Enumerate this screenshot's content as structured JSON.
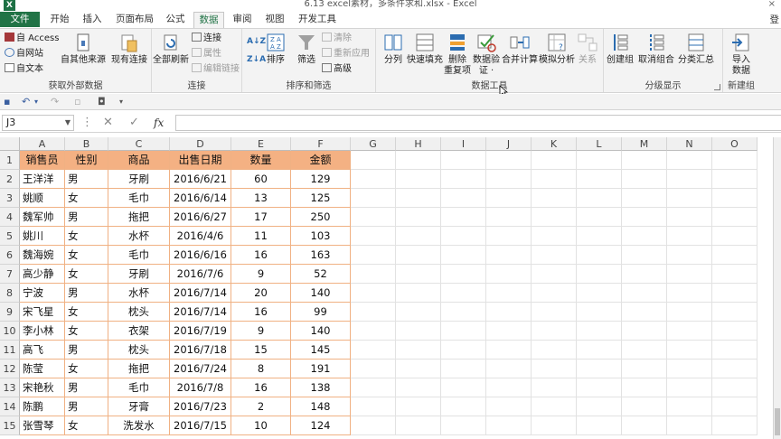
{
  "window": {
    "title": "6.13 excel素材，多条件求和.xlsx - Excel",
    "login": "登"
  },
  "tabs": [
    "文件",
    "开始",
    "插入",
    "页面布局",
    "公式",
    "数据",
    "审阅",
    "视图",
    "开发工具"
  ],
  "ribbon": {
    "get_external": {
      "access": "自 Access",
      "web": "自网站",
      "text": "自文本",
      "other": "自其他来源",
      "existing": "现有连接",
      "label": "获取外部数据"
    },
    "connections": {
      "refresh_all": "全部刷新",
      "connections": "连接",
      "properties": "属性",
      "edit_links": "编辑链接",
      "label": "连接"
    },
    "sort_filter": {
      "sort": "排序",
      "filter": "筛选",
      "clear": "清除",
      "reapply": "重新应用",
      "advanced": "高级",
      "label": "排序和筛选"
    },
    "data_tools": {
      "text_to_columns": "分列",
      "flash_fill": "快速填充",
      "remove_dup_1": "删除",
      "remove_dup_2": "重复项",
      "validation_1": "数据验",
      "validation_2": "证 ·",
      "consolidate": "合并计算",
      "what_if": "模拟分析",
      "relationships": "关系",
      "label": "数据工具"
    },
    "outline": {
      "group": "创建组",
      "ungroup": "取消组合",
      "subtotal": "分类汇总",
      "label": "分级显示"
    },
    "new_group": {
      "import_1": "导入",
      "import_2": "数据",
      "label": "新建组"
    }
  },
  "formula_bar": {
    "name_box": "J3",
    "fx": "fx",
    "value": ""
  },
  "columns": [
    "A",
    "B",
    "C",
    "D",
    "E",
    "F",
    "G",
    "H",
    "I",
    "J",
    "K",
    "L",
    "M",
    "N",
    "O"
  ],
  "rows": [
    "1",
    "2",
    "3",
    "4",
    "5",
    "6",
    "7",
    "8",
    "9",
    "10",
    "11",
    "12",
    "13",
    "14",
    "15"
  ],
  "table": {
    "headers": [
      "销售员",
      "性别",
      "商品",
      "出售日期",
      "数量",
      "金额"
    ],
    "records": [
      [
        "王洋洋",
        "男",
        "牙刷",
        "2016/6/21",
        "60",
        "129"
      ],
      [
        "姚顺",
        "女",
        "毛巾",
        "2016/6/14",
        "13",
        "125"
      ],
      [
        "魏军帅",
        "男",
        "拖把",
        "2016/6/27",
        "17",
        "250"
      ],
      [
        "姚川",
        "女",
        "水杯",
        "2016/4/6",
        "11",
        "103"
      ],
      [
        "魏海婉",
        "女",
        "毛巾",
        "2016/6/16",
        "16",
        "163"
      ],
      [
        "高少静",
        "女",
        "牙刷",
        "2016/7/6",
        "9",
        "52"
      ],
      [
        "宁波",
        "男",
        "水杯",
        "2016/7/14",
        "20",
        "140"
      ],
      [
        "宋飞星",
        "女",
        "枕头",
        "2016/7/14",
        "16",
        "99"
      ],
      [
        "李小林",
        "女",
        "衣架",
        "2016/7/19",
        "9",
        "140"
      ],
      [
        "高飞",
        "男",
        "枕头",
        "2016/7/18",
        "15",
        "145"
      ],
      [
        "陈莹",
        "女",
        "拖把",
        "2016/7/24",
        "8",
        "191"
      ],
      [
        "宋艳秋",
        "男",
        "毛巾",
        "2016/7/8",
        "16",
        "138"
      ],
      [
        "陈鹏",
        "男",
        "牙膏",
        "2016/7/23",
        "2",
        "148"
      ],
      [
        "张雪琴",
        "女",
        "洗发水",
        "2016/7/15",
        "10",
        "124"
      ]
    ]
  },
  "colors": {
    "header_fill": "#f4b183",
    "excel_green": "#217346"
  }
}
